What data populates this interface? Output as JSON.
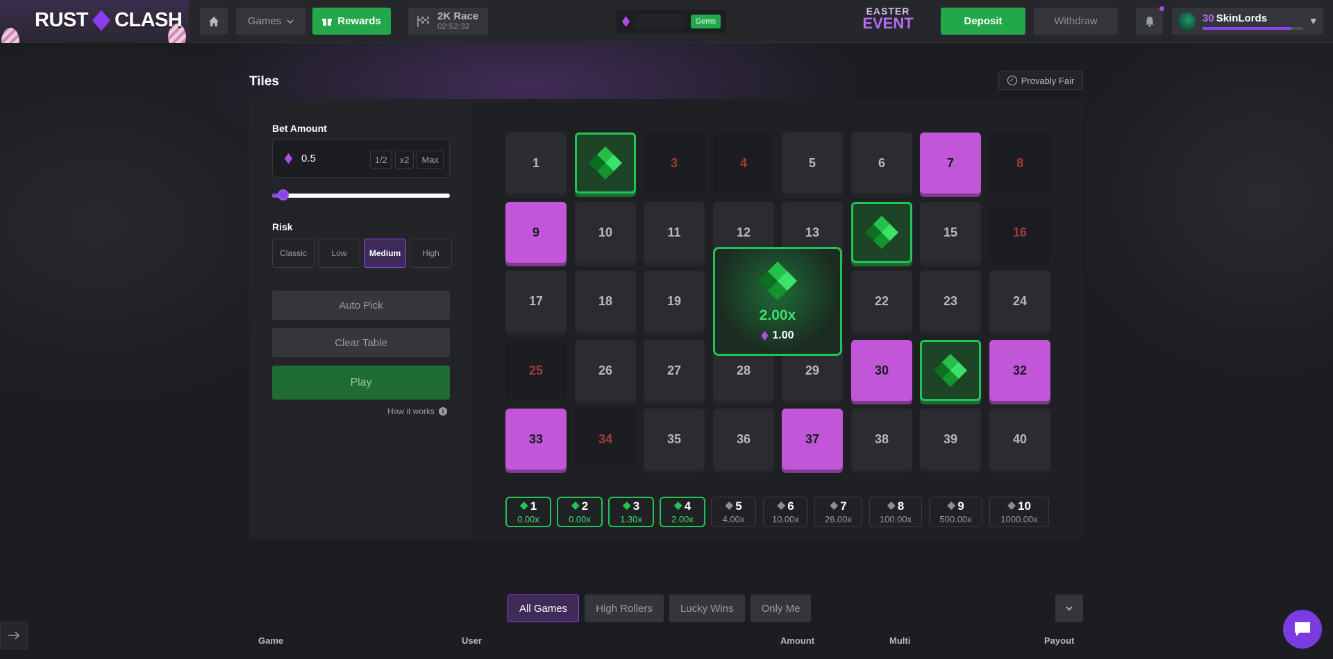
{
  "header": {
    "logo_left": "RUST",
    "logo_right": "CLASH",
    "nav_games": "Games",
    "nav_rewards": "Rewards",
    "race_title": "2K Race",
    "race_timer": "02:52:32",
    "gems_label": "Gems",
    "event_line1": "EASTER",
    "event_line2": "EVENT",
    "deposit": "Deposit",
    "withdraw": "Withdraw",
    "user_level": "30",
    "username": "SkinLords",
    "xp_progress": 0.88
  },
  "game": {
    "title": "Tiles",
    "provably_fair": "Provably Fair",
    "bet_label": "Bet Amount",
    "bet_value": "0.5",
    "bet_half": "1/2",
    "bet_double": "x2",
    "bet_max": "Max",
    "risk_label": "Risk",
    "risk_options": [
      "Classic",
      "Low",
      "Medium",
      "High"
    ],
    "risk_selected": "Medium",
    "auto_pick": "Auto Pick",
    "clear_table": "Clear Table",
    "play": "Play",
    "how_it_works": "How it works",
    "tiles": {
      "t1": "1",
      "t3": "3",
      "t4": "4",
      "t5": "5",
      "t6": "6",
      "t7": "7",
      "t8": "8",
      "t9": "9",
      "t10": "10",
      "t11": "11",
      "t12": "12",
      "t13": "13",
      "t15": "15",
      "t16": "16",
      "t17": "17",
      "t18": "18",
      "t19": "19",
      "t22": "22",
      "t23": "23",
      "t24": "24",
      "t25": "25",
      "t26": "26",
      "t27": "27",
      "t28": "28",
      "t29": "29",
      "t30": "30",
      "t32": "32",
      "t33": "33",
      "t34": "34",
      "t35": "35",
      "t36": "36",
      "t37": "37",
      "t38": "38",
      "t39": "39",
      "t40": "40"
    },
    "popup_multiplier": "2.00x",
    "popup_payout": "1.00",
    "multipliers": [
      {
        "hits": "1",
        "value": "0.00x"
      },
      {
        "hits": "2",
        "value": "0.00x"
      },
      {
        "hits": "3",
        "value": "1.30x"
      },
      {
        "hits": "4",
        "value": "2.00x"
      },
      {
        "hits": "5",
        "value": "4.00x"
      },
      {
        "hits": "6",
        "value": "10.00x"
      },
      {
        "hits": "7",
        "value": "26.00x"
      },
      {
        "hits": "8",
        "value": "100.00x"
      },
      {
        "hits": "9",
        "value": "500.00x"
      },
      {
        "hits": "10",
        "value": "1000.00x"
      }
    ]
  },
  "feed": {
    "tabs": [
      "All Games",
      "High Rollers",
      "Lucky Wins",
      "Only Me"
    ],
    "columns": [
      "Game",
      "User",
      "Amount",
      "Multi",
      "Payout"
    ]
  },
  "colors": {
    "accent_green": "#22a84a",
    "accent_purple": "#8b45e8",
    "tile_purple": "#c156d9"
  }
}
